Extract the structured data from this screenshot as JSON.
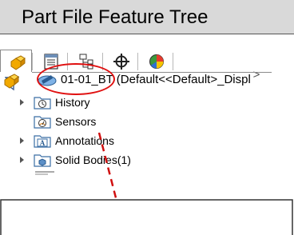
{
  "title": "Part File Feature Tree",
  "tabs": [
    {
      "icon": "feature-manager-icon",
      "active": true
    },
    {
      "icon": "property-manager-icon",
      "active": false
    },
    {
      "icon": "configuration-manager-icon",
      "active": false
    },
    {
      "icon": "dimxpert-icon",
      "active": false
    },
    {
      "icon": "display-manager-icon",
      "active": false
    }
  ],
  "scroll_right": ">",
  "root": {
    "label": "01-01_BT  (Default<<Default>_Displ"
  },
  "nodes": [
    {
      "label": "History",
      "icon": "history-icon",
      "expandable": true
    },
    {
      "label": "Sensors",
      "icon": "sensors-icon",
      "expandable": false
    },
    {
      "label": "Annotations",
      "icon": "annotations-icon",
      "expandable": true
    },
    {
      "label": "Solid Bodies(1)",
      "icon": "solid-bodies-icon",
      "expandable": true
    }
  ],
  "colors": {
    "title_bg": "#d9d9d9",
    "highlight": "#e01010",
    "folder": "#3a6ea5"
  }
}
